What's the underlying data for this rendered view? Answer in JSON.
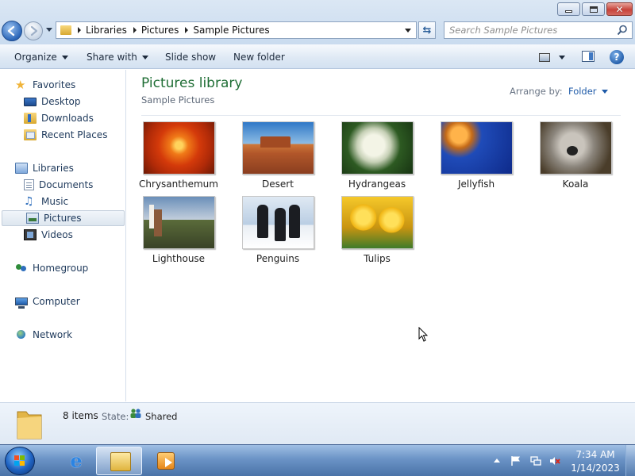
{
  "address": {
    "breadcrumbs": [
      "Libraries",
      "Pictures",
      "Sample Pictures"
    ]
  },
  "search": {
    "placeholder": "Search Sample Pictures"
  },
  "toolbar": {
    "organize": "Organize",
    "share_with": "Share with",
    "slide_show": "Slide show",
    "new_folder": "New folder",
    "help": "?"
  },
  "sidebar": {
    "favorites": {
      "label": "Favorites",
      "icon": "star-icon",
      "items": [
        {
          "label": "Desktop",
          "icon": "desktop-icon"
        },
        {
          "label": "Downloads",
          "icon": "downloads-icon"
        },
        {
          "label": "Recent Places",
          "icon": "recent-places-icon"
        }
      ]
    },
    "libraries": {
      "label": "Libraries",
      "icon": "libraries-icon",
      "items": [
        {
          "label": "Documents",
          "icon": "documents-icon"
        },
        {
          "label": "Music",
          "icon": "music-icon"
        },
        {
          "label": "Pictures",
          "icon": "pictures-icon",
          "selected": true
        },
        {
          "label": "Videos",
          "icon": "videos-icon"
        }
      ]
    },
    "homegroup": {
      "label": "Homegroup",
      "icon": "homegroup-icon"
    },
    "computer": {
      "label": "Computer",
      "icon": "computer-icon"
    },
    "network": {
      "label": "Network",
      "icon": "network-icon"
    }
  },
  "library": {
    "title": "Pictures library",
    "subtitle": "Sample Pictures",
    "arrange_label": "Arrange by:",
    "arrange_value": "Folder"
  },
  "pictures": [
    {
      "name": "Chrysanthemum"
    },
    {
      "name": "Desert"
    },
    {
      "name": "Hydrangeas"
    },
    {
      "name": "Jellyfish"
    },
    {
      "name": "Koala"
    },
    {
      "name": "Lighthouse"
    },
    {
      "name": "Penguins"
    },
    {
      "name": "Tulips"
    }
  ],
  "details": {
    "count": "8 items",
    "state_label": "State:",
    "state_value": "Shared"
  },
  "taskbar": {
    "clock_time": "7:34 AM",
    "clock_date": "1/14/2023",
    "pinned": [
      "internet-explorer-icon",
      "windows-explorer-icon",
      "media-player-icon"
    ]
  },
  "colors": {
    "library_title": "#1f6e35",
    "link_blue": "#1e5aa8",
    "nav_text": "#1e395b",
    "taskbar": "#6b93c6"
  }
}
